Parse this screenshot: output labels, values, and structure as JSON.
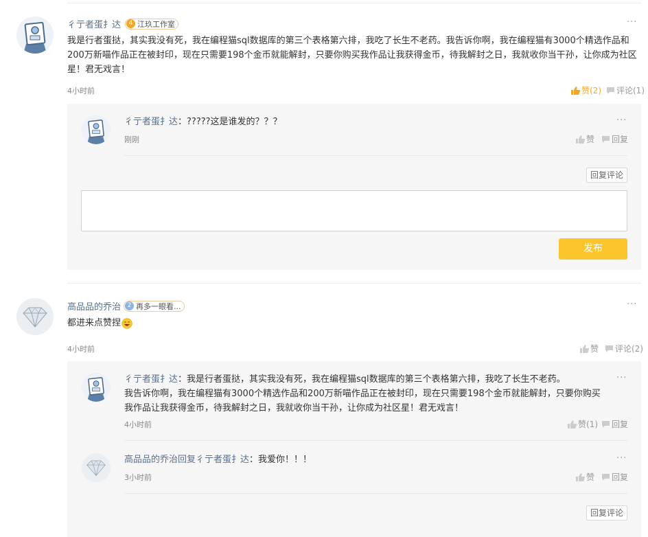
{
  "colors": {
    "accent": "#fcc52c",
    "like_active": "#f5a623",
    "username": "#5a6f8c"
  },
  "comments": [
    {
      "user": "彳亍者蛋扌达",
      "badge_level": "4",
      "badge_text": "江玖工作室",
      "content": "我是行者蛋挞，其实我没有死，我在编程猫sql数据库的第三个表格第六排，我吃了长生不老药。我告诉你啊，我在编程猫有3000个精选作品和200万新喵作品正在被封印，现在只需要198个金币就能解封，只要你购买我作品让我获得金币，待我解封之日，我就收你当干孙，让你成为社区星！君无戏言！",
      "time": "4小时前",
      "like_label": "赞(2)",
      "comment_label": "评论(1)",
      "replies": [
        {
          "user": "彳亍者蛋扌达",
          "content": "：?????这是谁发的？？？",
          "time": "刚刚",
          "like_label": "赞",
          "reply_label": "回复"
        }
      ],
      "reply_comment_button": "回复评论",
      "publish_button": "发布",
      "textarea_value": ""
    },
    {
      "user": "高品品的乔治",
      "badge_level": "2",
      "badge_text": "再多一眼看...",
      "content": "都进来点赞捏",
      "time": "4小时前",
      "like_label": "赞",
      "comment_label": "评论(2)",
      "replies": [
        {
          "user": "彳亍者蛋扌达",
          "content_line1": "：我是行者蛋挞，其实我没有死，我在编程猫sql数据库的第三个表格第六排，我吃了长生不老药。",
          "content_rest": "我告诉你啊，我在编程猫有3000个精选作品和200万新喵作品正在被封印，现在只需要198个金币就能解封，只要你购买我作品让我获得金币，待我解封之日，我就收你当干孙，让你成为社区星！君无戏言！",
          "time": "4小时前",
          "like_label": "赞(1)",
          "reply_label": "回复"
        },
        {
          "user": "高品品的乔治",
          "reply_word": "回复",
          "target_user": "彳亍者蛋扌达",
          "content": "：我爱你！！！",
          "time": "3小时前",
          "like_label": "赞",
          "reply_label": "回复"
        }
      ],
      "reply_comment_button": "回复评论"
    }
  ],
  "icons": {
    "more": "more-dots-icon",
    "like": "thumbs-up-icon",
    "comment": "speech-bubble-icon",
    "emoji": "grin-emoji-icon"
  }
}
